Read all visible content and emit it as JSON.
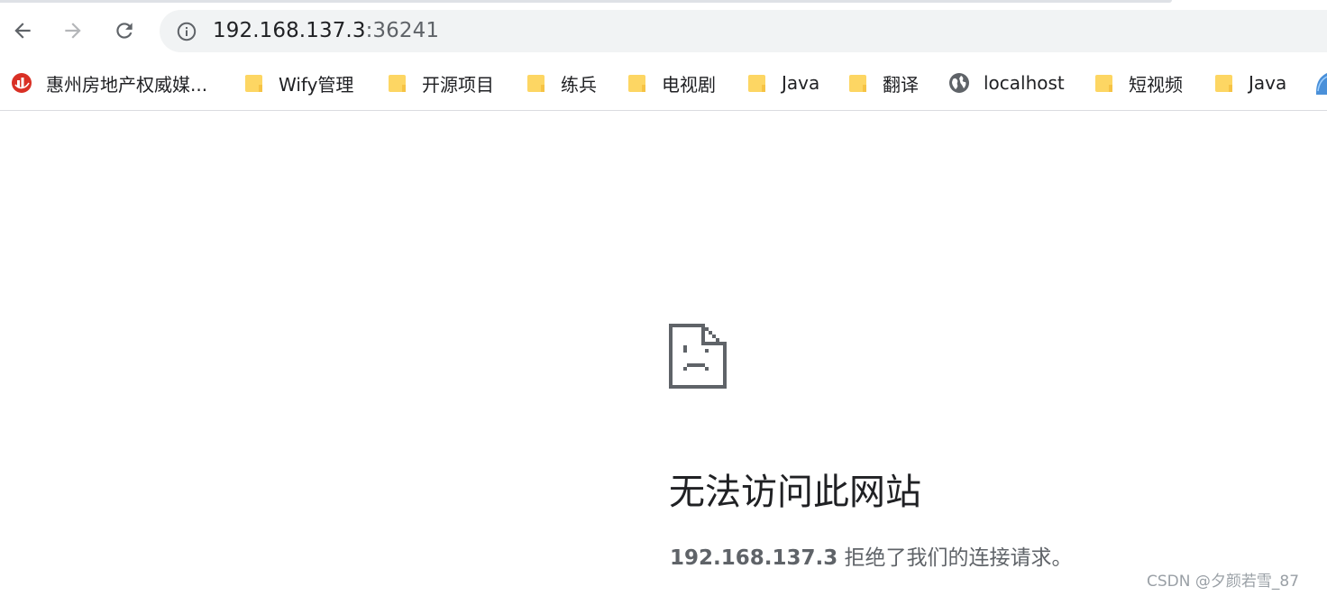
{
  "toolbar": {
    "url_host": "192.168.137.3",
    "url_port": ":36241"
  },
  "bookmarks": [
    {
      "label": "惠州房地产权威媒...",
      "icon": "site-logo-icon"
    },
    {
      "label": "Wify管理",
      "icon": "folder-icon"
    },
    {
      "label": "开源项目",
      "icon": "folder-icon"
    },
    {
      "label": "练兵",
      "icon": "folder-icon"
    },
    {
      "label": "电视剧",
      "icon": "folder-icon"
    },
    {
      "label": "Java",
      "icon": "folder-icon"
    },
    {
      "label": "翻译",
      "icon": "folder-icon"
    },
    {
      "label": "localhost",
      "icon": "globe-icon"
    },
    {
      "label": "短视频",
      "icon": "folder-icon"
    },
    {
      "label": "Java",
      "icon": "folder-icon"
    }
  ],
  "error": {
    "title": "无法访问此网站",
    "host": "192.168.137.3",
    "message": " 拒绝了我们的连接请求。"
  },
  "watermark": "CSDN @夕颜若雪_87",
  "colors": {
    "folder": "#fdd663",
    "icon_gray": "#5f6368",
    "omnibox_bg": "#f1f3f4"
  }
}
